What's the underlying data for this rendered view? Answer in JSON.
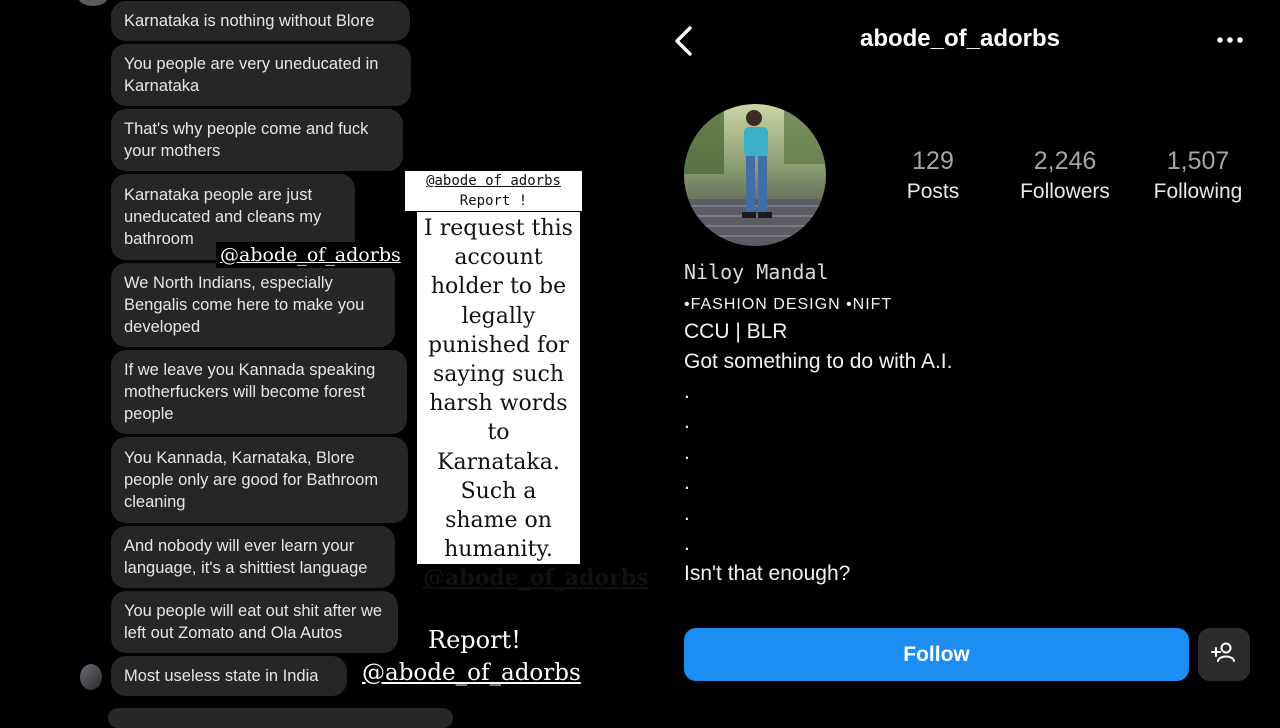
{
  "chat": {
    "messages": [
      "Karnataka is nothing without Blore",
      "You people are very uneducated in Karnataka",
      "That's why people come and fuck your mothers",
      "Karnataka people are just uneducated and cleans my bathroom",
      "We North Indians, especially Bengalis come here to make you developed",
      "If we leave you Kannada speaking motherfuckers will become forest people",
      "You Kannada, Karnataka, Blore people only are good for Bathroom cleaning",
      "And nobody will ever learn your language, it's a shittiest language",
      "You people will eat out shit after we left out Zomato and Ola Autos",
      "Most useless state in India"
    ]
  },
  "overlay": {
    "tag_mid": "@abode_of_adorbs",
    "report_small_handle": "@abode of adorbs",
    "report_small_label": "Report !",
    "note_text": "I request this account holder to be legally punished for saying such harsh words to Karnataka. Such a shame on humanity.",
    "note_handle": "@abode_of_adorbs",
    "report_big": "Report!",
    "tag_bottom": "@abode_of_adorbs"
  },
  "profile": {
    "username": "abode_of_adorbs",
    "stats": {
      "posts_count": "129",
      "posts_label": "Posts",
      "followers_count": "2,246",
      "followers_label": "Followers",
      "following_count": "1,507",
      "following_label": "Following"
    },
    "full_name": "Niloy Mandal",
    "bio": {
      "tagline": "•FASHION DESIGN •NIFT",
      "location": "CCU | BLR",
      "line3": "Got something to do with A.I.",
      "dots": [
        ".",
        ".",
        ".",
        ".",
        ".",
        "."
      ],
      "closing": "Isn't that enough?"
    },
    "follow_label": "Follow",
    "icons": {
      "back": "chevron-left-icon",
      "more": "more-horizontal-icon",
      "suggest": "add-person-icon"
    },
    "colors": {
      "follow_button": "#1b8df3",
      "background": "#000000"
    }
  }
}
